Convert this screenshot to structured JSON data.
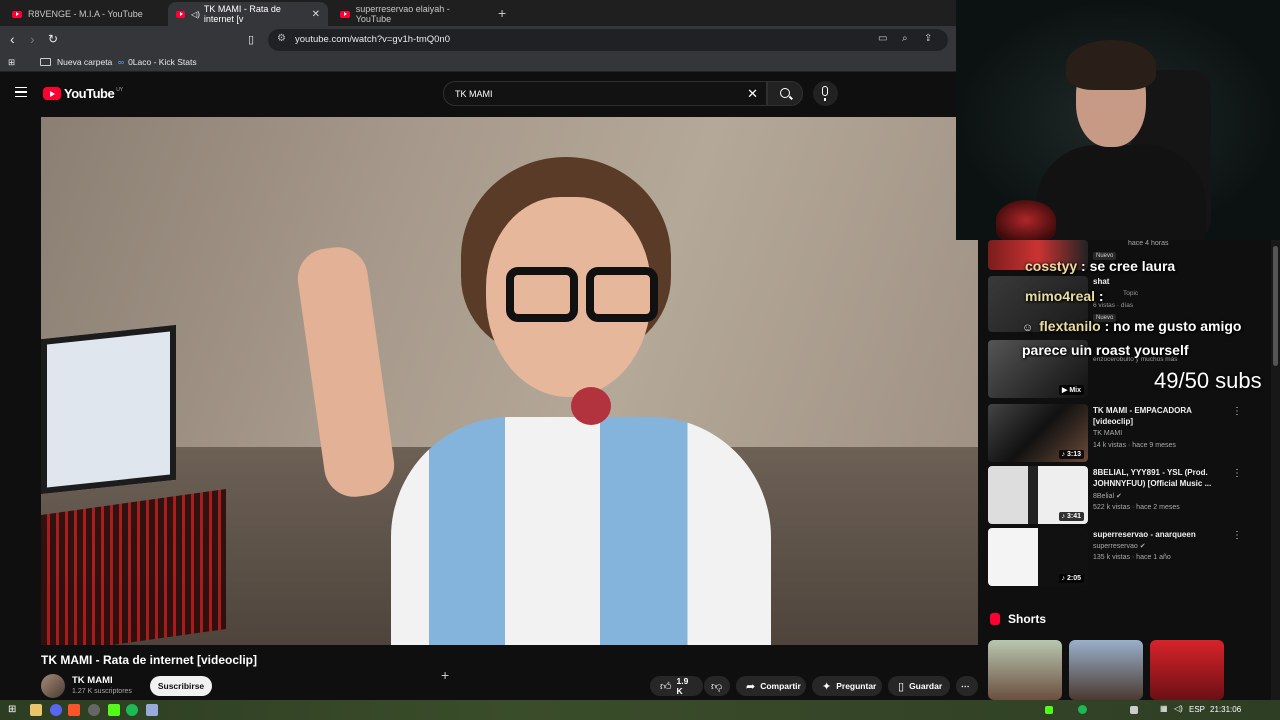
{
  "browser": {
    "tabs": [
      {
        "label": "R8VENGE - M.I.A - YouTube",
        "active": false
      },
      {
        "label": "TK MAMI - Rata de internet [v",
        "active": true
      },
      {
        "label": "superreservao elaiyah - YouTube",
        "active": false
      }
    ],
    "url": "youtube.com/watch?v=gv1h-tmQ0n0",
    "bookmarks": [
      {
        "label": "Nueva carpeta"
      },
      {
        "label": "0Laco - Kick Stats"
      }
    ]
  },
  "youtube": {
    "logo_text": "YouTube",
    "country": "UY",
    "search_query": "TK MAMI",
    "video": {
      "title": "TK MAMI - Rata de internet [videoclip]",
      "channel": "TK MAMI",
      "subscribers": "1.27 K suscriptores",
      "subscribe_label": "Suscribirse",
      "likes": "1.9 K",
      "share_label": "Compartir",
      "ask_label": "Preguntar",
      "save_label": "Guardar"
    },
    "recommendations": [
      {
        "title": "TK MAMI - EMPACADORA [videoclip]",
        "channel": "TK MAMI",
        "meta": "14 k vistas · hace 9 meses",
        "duration": "3:13"
      },
      {
        "title": "8BELIAL, YYY891 - YSL (Prod. JOHNNYFUU) [Official Music ...",
        "channel": "8Belial",
        "meta": "522 k vistas · hace 2 meses",
        "duration": "3:41"
      },
      {
        "title": "superreservao - anarqueen",
        "channel": "superreservao",
        "meta": "135 k vistas · hace 1 año",
        "duration": "2:05"
      }
    ],
    "partial_items": {
      "item1_meta": "hace 4 horas",
      "item1_badge": "Nuevo",
      "item2_title": "shat",
      "item2_channel": "Topic",
      "item2_meta": "6 vistas · días",
      "item2_badge": "Nuevo",
      "mix_sub": "enzocerobulto y muchos más",
      "mix_label": "Mix"
    },
    "shorts_label": "Shorts"
  },
  "stream_overlay": {
    "chat": [
      {
        "user": "cosstyy",
        "text": " : se cree laura"
      },
      {
        "user": "mimo4real",
        "text": " :"
      },
      {
        "user": "flextanilo",
        "text": " : no me gusto amigo"
      },
      {
        "user": "",
        "text": "parece uin roast yourself"
      }
    ],
    "sub_goal": "49/50 subs"
  },
  "taskbar": {
    "lang": "ESP",
    "time": "21:31:06"
  }
}
